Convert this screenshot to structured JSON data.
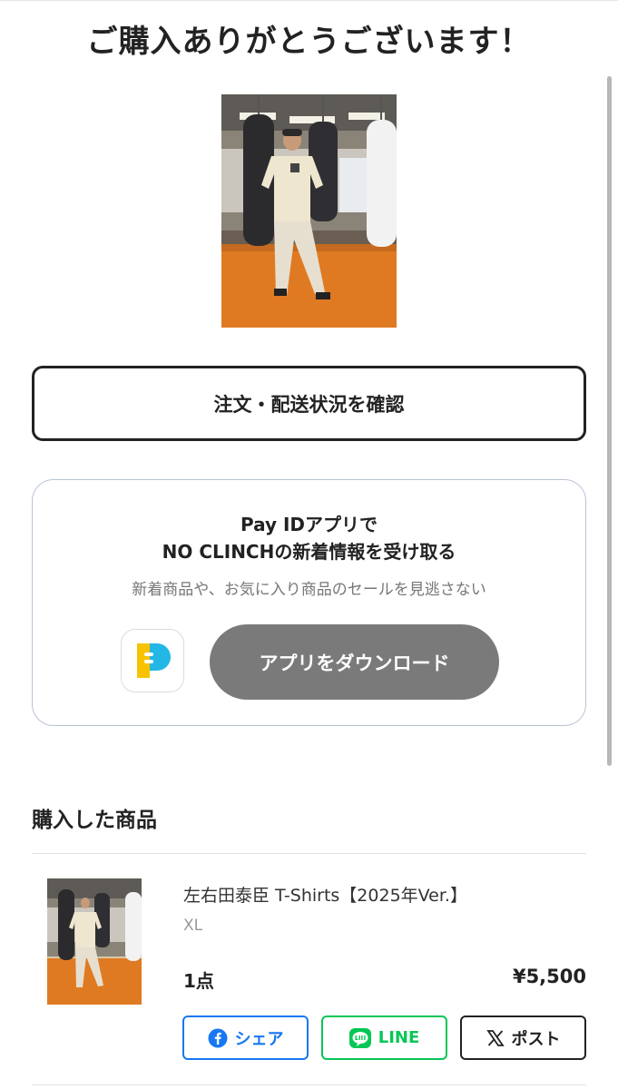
{
  "title": "ご購入ありがとうございます！",
  "order_status_button": "注文・配送状況を確認",
  "app_card": {
    "title_line1": "Pay IDアプリで",
    "title_line2": "NO CLINCHの新着情報を受け取る",
    "subtitle": "新着商品や、お気に入り商品のセールを見逃さない",
    "download_label": "アプリをダウンロード",
    "app_icon": "pay-id-app-icon"
  },
  "purchased": {
    "section_title": "購入した商品",
    "items": [
      {
        "name": "左右田泰臣 T-Shirts【2025年Ver.】",
        "variant": "XL",
        "quantity": "1点",
        "price": "¥5,500"
      }
    ]
  },
  "share": {
    "facebook_label": "シェア",
    "line_label": "LINE",
    "x_label": "ポスト"
  },
  "colors": {
    "download_button": "#7a7a7a",
    "facebook": "#1877f2",
    "line": "#06c755",
    "text": "#222222"
  }
}
